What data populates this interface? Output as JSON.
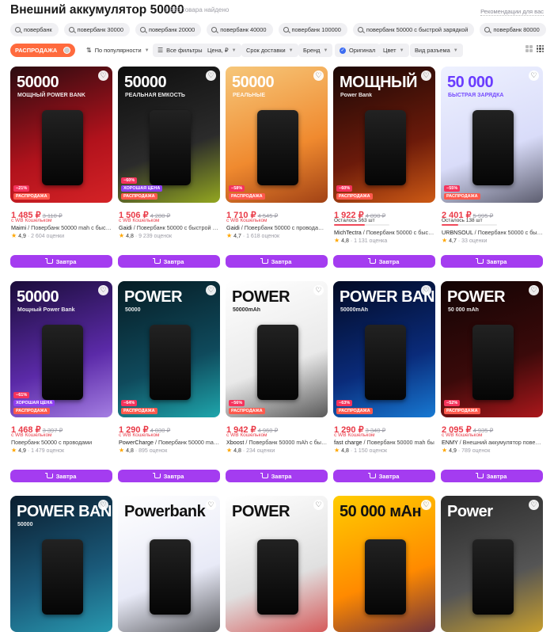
{
  "header": {
    "title": "Внешний аккумулятор 50000",
    "count": "1 863 товара найдено",
    "recs": "Рекомендации для вас"
  },
  "search_chips": [
    "повербанк",
    "повербанк 30000",
    "повербанк 20000",
    "повербанк 40000",
    "повербанк 100000",
    "повербанк 50000 с быстрой зарядкой",
    "повербанк 80000"
  ],
  "filters": {
    "sale": "РАСПРОДАЖА",
    "sort": "По популярности",
    "all": "Все фильтры",
    "price": "Цена, ₽",
    "delivery": "Срок доставки",
    "brand": "Бренд",
    "original": "Оригинал",
    "color": "Цвет",
    "connector": "Вид разъема"
  },
  "labels": {
    "wallet": "с WB Кошельком",
    "buy": "Завтра"
  },
  "products": [
    {
      "price": "1 485 ₽",
      "old": "3 110 ₽",
      "brand": "Maimi",
      "title": " / Повербанк 50000 mah с быстрой",
      "rating": "4,9",
      "reviews": "· 2 604 оценки",
      "badges": [
        "−21%",
        "РАСПРОДАЖА"
      ],
      "pic_text": "50000",
      "pic_sub": "МОЩНЫЙ POWER BANK",
      "colors": [
        "#2a0b10",
        "#b1121c",
        "#e62b2b"
      ],
      "label_color": "#fff"
    },
    {
      "price": "1 506 ₽",
      "old": "4 280 ₽",
      "brand": "Gaidi",
      "title": " / Повербанк 50000 с быстрой зарядкой",
      "rating": "4,8",
      "reviews": "· 9 239 оценок",
      "badges": [
        "−60%",
        "ХОРОШАЯ ЦЕНА",
        "РАСПРОДАЖА"
      ],
      "pic_text": "50000",
      "pic_sub": "РЕАЛЬНАЯ ЕМКОСТЬ",
      "colors": [
        "#0e0e0e",
        "#2b2b2b",
        "#c8e61b"
      ],
      "label_color": "#fff"
    },
    {
      "price": "1 710 ₽",
      "old": "4 545 ₽",
      "brand": "Gaidi",
      "title": " / Повербанк 50000 с проводами и",
      "rating": "4,7",
      "reviews": "· 1 618 оценок",
      "badges": [
        "−58%",
        "РАСПРОДАЖА"
      ],
      "pic_text": "50000",
      "pic_sub": "РЕАЛЬНЫЕ",
      "colors": [
        "#f6c77a",
        "#f08a2f",
        "#7a1e08"
      ],
      "label_color": "#fff"
    },
    {
      "price": "1 922 ₽",
      "old": "4 890 ₽",
      "left": "Осталось 563 шт",
      "bar": 0.55,
      "brand": "MichTectra",
      "title": " / Повербанк 50000 с быстрой",
      "rating": "4,8",
      "reviews": "· 1 131 оценка",
      "badges": [
        "−60%",
        "РАСПРОДАЖА"
      ],
      "pic_text": "МОЩНЫЙ",
      "pic_sub": "Power Bank",
      "colors": [
        "#1b0806",
        "#6b1a0a",
        "#ff7a1a"
      ],
      "label_color": "#fff"
    },
    {
      "price": "2 401 ₽",
      "old": "5 995 ₽",
      "left": "Осталось 138 шт",
      "bar": 0.3,
      "brand": "URBNSOUL",
      "title": " / Повербанк 50000 с быстрой",
      "rating": "4,7",
      "reviews": "· 33 оценки",
      "badges": [
        "−55%",
        "РАСПРОДАЖА"
      ],
      "pic_text": "50 000",
      "pic_sub": "БЫСТРАЯ ЗАРЯДКА",
      "colors": [
        "#eef1ff",
        "#d9dcf9",
        "#1e1e2a"
      ],
      "label_color": "#6a3cff"
    },
    {
      "price": "1 468 ₽",
      "old": "3 397 ₽",
      "brand": "",
      "title": "Повербанк 50000 с проводами",
      "rating": "4,9",
      "reviews": "· 1 479 оценок",
      "badges": [
        "−61%",
        "ХОРОШАЯ ЦЕНА",
        "РАСПРОДАЖА"
      ],
      "pic_text": "50000",
      "pic_sub": "Мощный Power Bank",
      "colors": [
        "#1b0d3a",
        "#5b2aa8",
        "#c9a8ff"
      ],
      "label_color": "#fff"
    },
    {
      "price": "1 290 ₽",
      "old": "4 030 ₽",
      "brand": "PowerCharge",
      "title": " / Повербанк 50000 mah р",
      "rating": "4,8",
      "reviews": "· 895 оценок",
      "badges": [
        "−64%",
        "РАСПРОДАЖА"
      ],
      "pic_text": "POWER",
      "pic_sub": "50000",
      "colors": [
        "#061c24",
        "#0f4a5c",
        "#26d4d4"
      ],
      "label_color": "#fff"
    },
    {
      "price": "1 942 ₽",
      "old": "4 960 ₽",
      "brand": "Xboost",
      "title": " / Повербанк 50000 mAh с быстр",
      "rating": "4,8",
      "reviews": "· 234 оценки",
      "badges": [
        "−56%",
        "РАСПРОДАЖА"
      ],
      "pic_text": "POWER",
      "pic_sub": "50000mAh",
      "colors": [
        "#ffffff",
        "#e9e9e9",
        "#111111"
      ],
      "label_color": "#111"
    },
    {
      "price": "1 290 ₽",
      "old": "3 340 ₽",
      "brand": "fast charge",
      "title": " / Повербанк 50000 mah бы",
      "rating": "4,8",
      "reviews": "· 1 150 оценок",
      "badges": [
        "−63%",
        "РАСПРОДАЖА"
      ],
      "pic_text": "POWER BANK",
      "pic_sub": "50000mAh",
      "colors": [
        "#020a24",
        "#0a2b7a",
        "#1ea0ff"
      ],
      "label_color": "#fff"
    },
    {
      "price": "2 095 ₽",
      "old": "4 935 ₽",
      "brand": "ENMY",
      "title": " / Внешний аккумулятор повербанк",
      "rating": "4,9",
      "reviews": "· 789 оценок",
      "badges": [
        "−52%",
        "РАСПРОДАЖА"
      ],
      "pic_text": "POWER",
      "pic_sub": "50 000 mAh",
      "colors": [
        "#120404",
        "#3a0a0a",
        "#e31e24"
      ],
      "label_color": "#fff"
    },
    {
      "pic_text": "POWER BANK",
      "pic_sub": "50000",
      "colors": [
        "#0b1d2e",
        "#1a5a7a",
        "#2fb7c9"
      ],
      "label_color": "#fff"
    },
    {
      "pic_text": "Powerbank",
      "pic_sub": "",
      "colors": [
        "#ffffff",
        "#e8eaf7",
        "#1a1a1a"
      ],
      "label_color": "#111"
    },
    {
      "pic_text": "POWER",
      "pic_sub": "",
      "colors": [
        "#ffffff",
        "#e0e0e0",
        "#d01818"
      ],
      "label_color": "#111"
    },
    {
      "pic_text": "50 000 мАн",
      "pic_sub": "",
      "colors": [
        "#ffcc00",
        "#ff8a00",
        "#2a0a5a"
      ],
      "label_color": "#111"
    },
    {
      "pic_text": "Power",
      "pic_sub": "",
      "colors": [
        "#2a2a2a",
        "#555555",
        "#ffc21a"
      ],
      "label_color": "#fff"
    }
  ]
}
